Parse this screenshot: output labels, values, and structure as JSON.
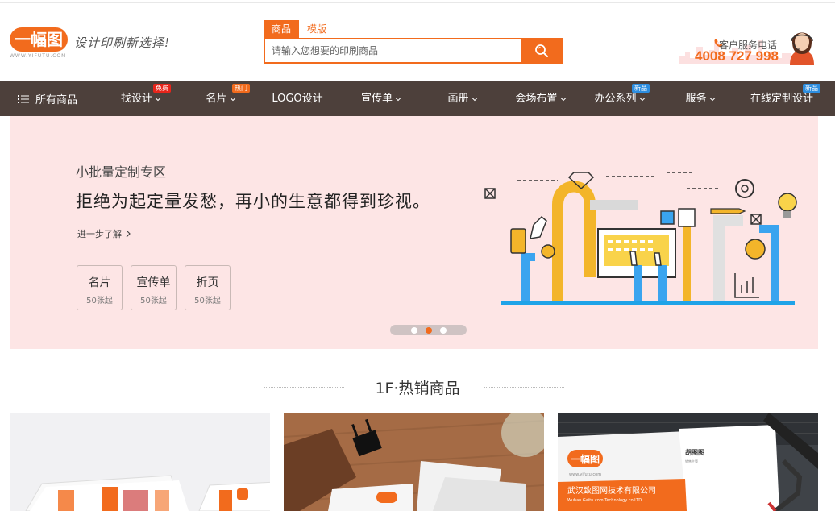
{
  "header": {
    "logo_text": "一幅图",
    "logo_url": "WWW.YIFUTU.COM",
    "slogan": "设计印刷新选择!",
    "search": {
      "tabs": [
        "商品",
        "模版"
      ],
      "placeholder": "请输入您想要的印刷商品"
    },
    "service": {
      "label": "客户服务电话",
      "phone": "4008 727 998"
    }
  },
  "nav": {
    "all_label": "所有商品",
    "items": [
      {
        "label": "找设计",
        "badge": "免费",
        "badge_color": "#e8251b"
      },
      {
        "label": "名片",
        "badge": "热门",
        "badge_color": "#f26b1d"
      },
      {
        "label": "LOGO设计"
      },
      {
        "label": "宣传单"
      },
      {
        "label": "画册"
      },
      {
        "label": "会场布置"
      },
      {
        "label": "办公系列",
        "badge": "新品",
        "badge_color": "#2d8ee0"
      },
      {
        "label": "服务"
      },
      {
        "label": "在线定制设计",
        "badge": "新品",
        "badge_color": "#2d8ee0"
      }
    ]
  },
  "banner": {
    "subtitle": "小批量定制专区",
    "title": "拒绝为起定量发愁，再小的生意都得到珍视。",
    "more": "进一步了解",
    "cards": [
      {
        "name": "名片",
        "min": "50张起"
      },
      {
        "name": "宣传单",
        "min": "50张起"
      },
      {
        "name": "折页",
        "min": "50张起"
      }
    ],
    "slide_count": 3,
    "active_slide": 1
  },
  "floor": {
    "title": "1F·热销商品"
  },
  "products": {
    "card_company": "武汉致图网技术有限公司",
    "card_company_en": "Wuhan Gaitu.com Technology co.LTD",
    "card_name": "胡图图",
    "card_title": "销售主管",
    "card_url": "www.yifutu.com"
  },
  "colors": {
    "accent": "#f26b1d",
    "nav_bg": "#4d403b",
    "banner_bg": "#fde5e5"
  }
}
